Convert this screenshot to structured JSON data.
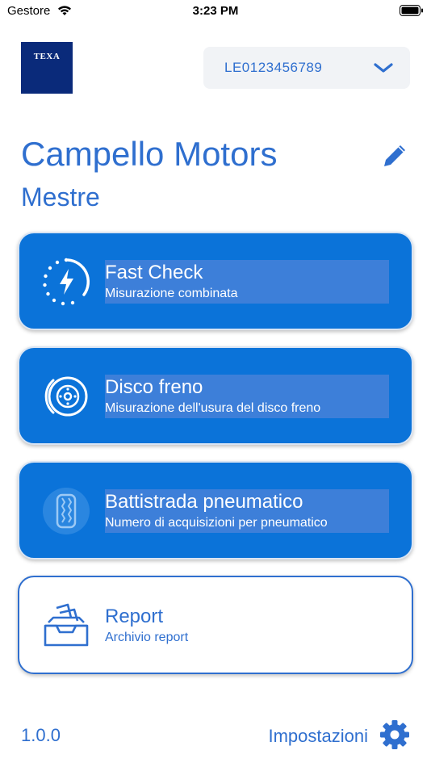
{
  "status_bar": {
    "carrier": "Gestore",
    "time": "3:23 PM"
  },
  "header": {
    "logo_text": "TEXA",
    "device_id": "LE0123456789"
  },
  "workshop": {
    "name": "Campello Motors",
    "city": "Mestre"
  },
  "cards": [
    {
      "title": "Fast Check",
      "subtitle": "Misurazione combinata",
      "icon": "fast-check-icon"
    },
    {
      "title": "Disco freno",
      "subtitle": "Misurazione dell'usura del disco freno",
      "icon": "brake-disc-icon"
    },
    {
      "title": "Battistrada pneumatico",
      "subtitle": "Numero di acquisizioni per pneumatico",
      "icon": "tire-tread-icon"
    },
    {
      "title": "Report",
      "subtitle": "Archivio report",
      "icon": "archive-tray-icon"
    }
  ],
  "footer": {
    "version": "1.0.0",
    "settings_label": "Impostazioni"
  },
  "colors": {
    "accent": "#2f6fcf",
    "card_blue": "#0b73d9",
    "logo_navy": "#0a2a7a"
  }
}
